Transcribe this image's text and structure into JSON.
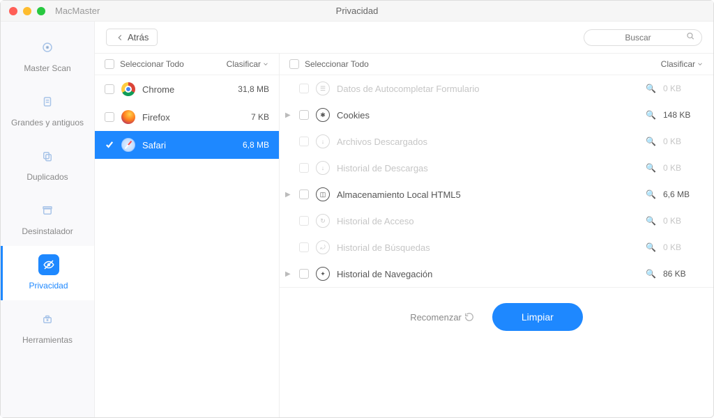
{
  "app_name": "MacMaster",
  "window_title": "Privacidad",
  "back_label": "Atrás",
  "search_placeholder": "Buscar",
  "sidebar": {
    "items": [
      {
        "label": "Master Scan"
      },
      {
        "label": "Grandes y antiguos"
      },
      {
        "label": "Duplicados"
      },
      {
        "label": "Desinstalador"
      },
      {
        "label": "Privacidad"
      },
      {
        "label": "Herramientas"
      }
    ]
  },
  "left": {
    "select_all": "Seleccionar Todo",
    "sort": "Clasificar"
  },
  "browsers": [
    {
      "name": "Chrome",
      "size": "31,8 MB"
    },
    {
      "name": "Firefox",
      "size": "7 KB"
    },
    {
      "name": "Safari",
      "size": "6,8 MB"
    }
  ],
  "right": {
    "select_all": "Seleccionar Todo",
    "sort": "Clasificar"
  },
  "details": [
    {
      "label": "Datos de Autocompletar Formulario",
      "size": "0 KB"
    },
    {
      "label": "Cookies",
      "size": "148 KB"
    },
    {
      "label": "Archivos Descargados",
      "size": "0 KB"
    },
    {
      "label": "Historial de Descargas",
      "size": "0 KB"
    },
    {
      "label": "Almacenamiento Local HTML5",
      "size": "6,6 MB"
    },
    {
      "label": "Historial de Acceso",
      "size": "0 KB"
    },
    {
      "label": "Historial de Búsquedas",
      "size": "0 KB"
    },
    {
      "label": "Historial de Navegación",
      "size": "86 KB"
    }
  ],
  "footer": {
    "rescan": "Recomenzar",
    "clean": "Limpiar"
  }
}
